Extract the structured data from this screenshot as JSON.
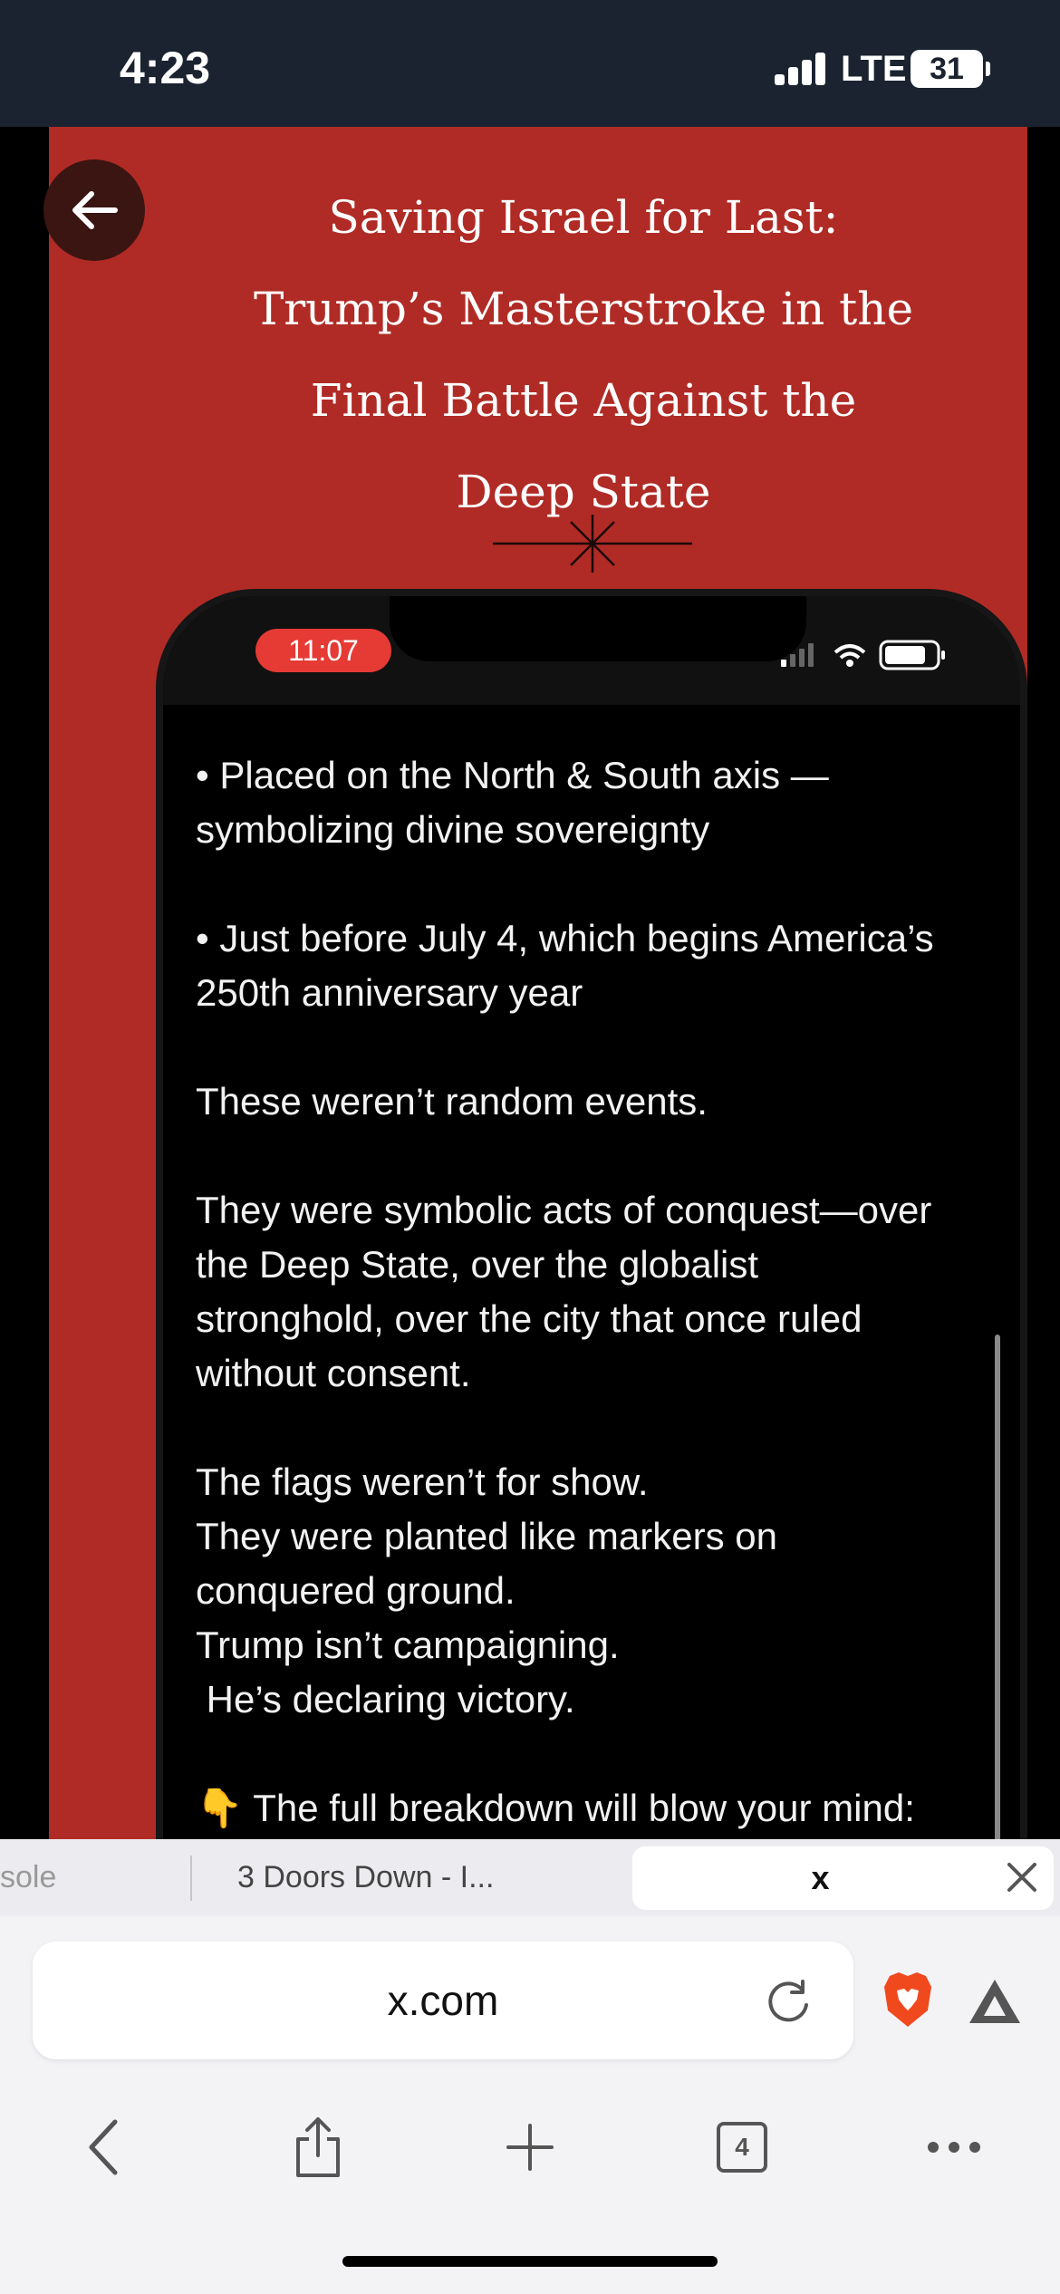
{
  "status_bar": {
    "time": "4:23",
    "carrier": "LTE",
    "battery_level": "31"
  },
  "post_image": {
    "headline": "Saving Israel for Last:\nTrump’s Masterstroke in the\nFinal Battle Against the\nDeep State",
    "phone": {
      "time": "11:07",
      "body": "• Placed on the North & South axis —\nsymbolizing divine sovereignty\n\n• Just before July 4, which begins America’s\n250th anniversary year\n\nThese weren’t random events.\n\nThey were symbolic acts of conquest—over\nthe Deep State, over the globalist\nstronghold, over the city that once ruled\nwithout consent.\n\nThe flags weren’t for show.\nThey were planted like markers on\nconquered ground.\nTrump isn’t campaigning.\n He’s declaring victory.\n\n👇 The full breakdown will blow your mind:"
    }
  },
  "tabs": [
    {
      "label": "sole"
    },
    {
      "label": "3 Doors Down - I..."
    },
    {
      "label": "x",
      "active": true
    }
  ],
  "address_bar": {
    "url": "x.com"
  },
  "toolbar": {
    "tab_count": "4"
  },
  "colors": {
    "panel_red": "#b02b25",
    "status_bar_bg": "#1b2330",
    "brave_orange": "#f0491e"
  }
}
